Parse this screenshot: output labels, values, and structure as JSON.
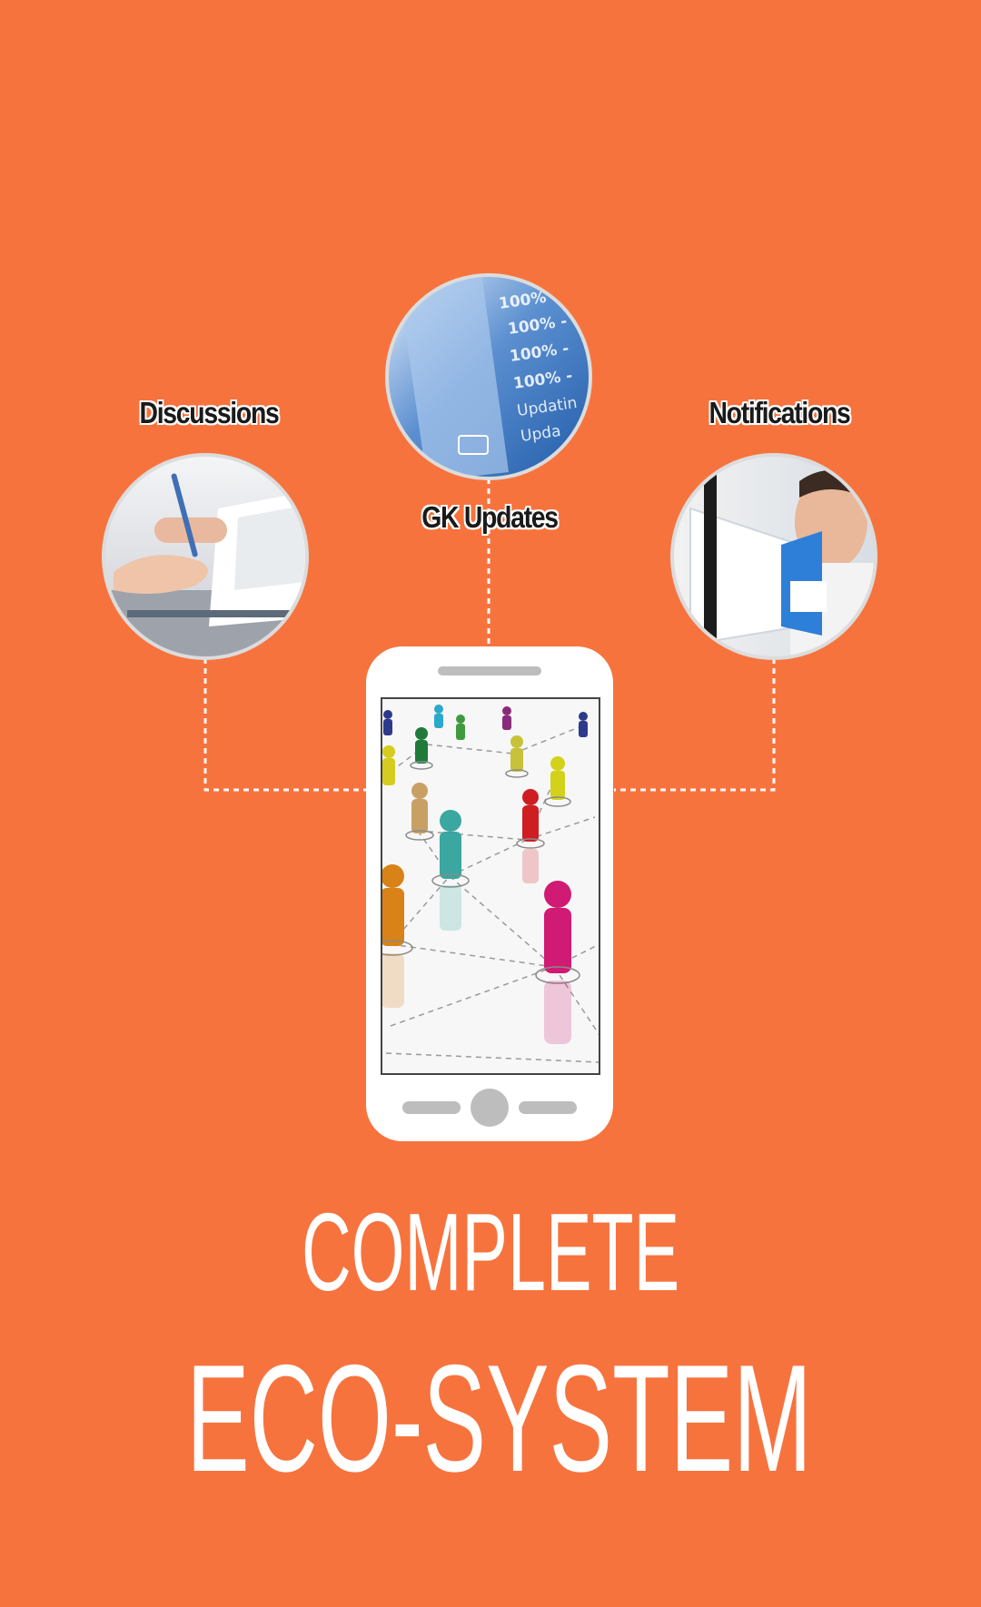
{
  "features": {
    "discussions": {
      "label": "Discussions",
      "icon": "handshake-document-photo"
    },
    "gk_updates": {
      "label": "GK Updates",
      "icon": "progress-screen-photo"
    },
    "notifications": {
      "label": "Notifications",
      "icon": "megaphone-photo"
    }
  },
  "phone": {
    "screen_image": "network-of-people-figures"
  },
  "headline": {
    "line1": "COMPLETE",
    "line2": "ECO-SYSTEM"
  },
  "colors": {
    "background": "#F7733E",
    "text": "#FFFFFF",
    "phone_body": "#FFFFFF",
    "circle_border": "#D9D9D9"
  }
}
